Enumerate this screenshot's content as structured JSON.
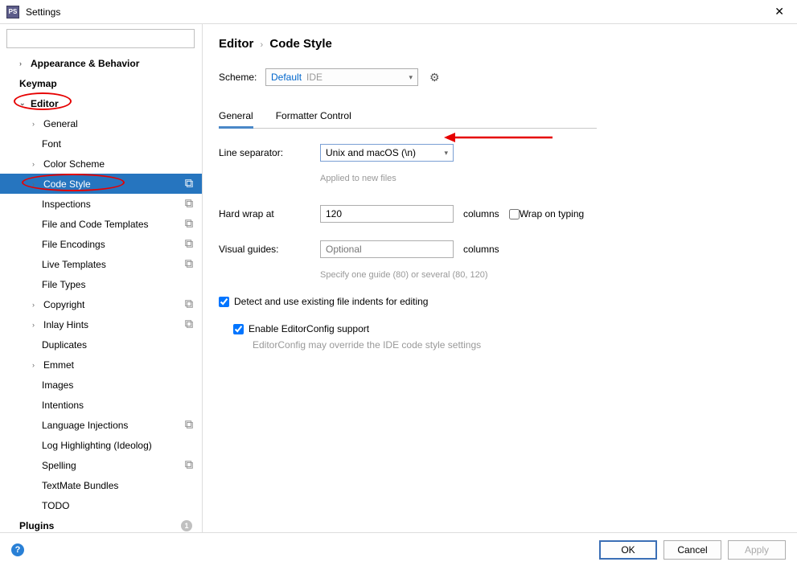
{
  "window": {
    "title": "Settings",
    "close_glyph": "✕"
  },
  "search": {
    "placeholder": "",
    "icon_glyph": "🔍"
  },
  "sidebar": {
    "items": [
      {
        "label": "Appearance & Behavior",
        "level": 1,
        "expandable": true
      },
      {
        "label": "Keymap",
        "level": 1,
        "expandable": false
      },
      {
        "label": "Editor",
        "level": 1,
        "expandable": true,
        "expanded": true,
        "annot_oval": true
      },
      {
        "label": "General",
        "level": 2,
        "expandable": true
      },
      {
        "label": "Font",
        "level": 2
      },
      {
        "label": "Color Scheme",
        "level": 2,
        "expandable": true
      },
      {
        "label": "Code Style",
        "level": 2,
        "expandable": true,
        "selected": true,
        "copy_icon": true,
        "annot_oval": true
      },
      {
        "label": "Inspections",
        "level": 2,
        "copy_icon": true
      },
      {
        "label": "File and Code Templates",
        "level": 2,
        "copy_icon": true
      },
      {
        "label": "File Encodings",
        "level": 2,
        "copy_icon": true
      },
      {
        "label": "Live Templates",
        "level": 2,
        "copy_icon": true
      },
      {
        "label": "File Types",
        "level": 2
      },
      {
        "label": "Copyright",
        "level": 2,
        "expandable": true,
        "copy_icon": true
      },
      {
        "label": "Inlay Hints",
        "level": 2,
        "expandable": true,
        "copy_icon": true
      },
      {
        "label": "Duplicates",
        "level": 2
      },
      {
        "label": "Emmet",
        "level": 2,
        "expandable": true
      },
      {
        "label": "Images",
        "level": 2
      },
      {
        "label": "Intentions",
        "level": 2
      },
      {
        "label": "Language Injections",
        "level": 2,
        "copy_icon": true
      },
      {
        "label": "Log Highlighting (Ideolog)",
        "level": 2
      },
      {
        "label": "Spelling",
        "level": 2,
        "copy_icon": true
      },
      {
        "label": "TextMate Bundles",
        "level": 2
      },
      {
        "label": "TODO",
        "level": 2
      },
      {
        "label": "Plugins",
        "level": 1,
        "expandable": false,
        "badge": "1"
      }
    ]
  },
  "breadcrumb": {
    "segment1": "Editor",
    "sep": "›",
    "segment2": "Code Style"
  },
  "scheme": {
    "label": "Scheme:",
    "name": "Default",
    "tag": "IDE",
    "gear_glyph": "⚙"
  },
  "tabs": [
    {
      "label": "General",
      "active": true
    },
    {
      "label": "Formatter Control",
      "active": false
    }
  ],
  "form": {
    "line_sep_label": "Line separator:",
    "line_sep_value": "Unix and macOS (\\n)",
    "line_sep_hint": "Applied to new files",
    "hard_wrap_label": "Hard wrap at",
    "hard_wrap_value": "120",
    "columns": "columns",
    "wrap_typing": "Wrap on typing",
    "visual_guides_label": "Visual guides:",
    "visual_guides_placeholder": "Optional",
    "visual_guides_hint": "Specify one guide (80) or several (80, 120)",
    "detect_indents": "Detect and use existing file indents for editing",
    "editorconfig": "Enable EditorConfig support",
    "editorconfig_hint": "EditorConfig may override the IDE code style settings"
  },
  "footer": {
    "ok": "OK",
    "cancel": "Cancel",
    "apply": "Apply"
  }
}
